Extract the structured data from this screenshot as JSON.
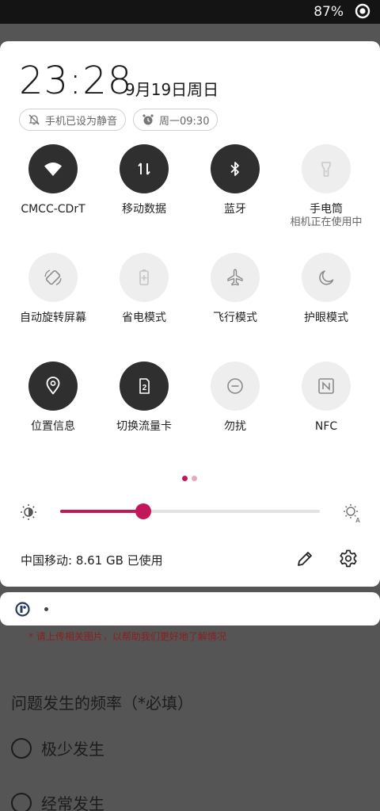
{
  "status_bar": {
    "battery_text": "87%",
    "status_icon": "target-icon"
  },
  "panel": {
    "time": "23:28",
    "date": "9月19日周日",
    "chips": [
      {
        "label": "手机已设为静音",
        "icon": "bell-off-icon"
      },
      {
        "label": "周一09:30",
        "icon": "alarm-clock-icon"
      }
    ],
    "tiles": [
      {
        "label": "CMCC-CDrT",
        "icon": "wifi-icon",
        "state": "on"
      },
      {
        "label": "移动数据",
        "icon": "mobile-data-icon",
        "state": "on"
      },
      {
        "label": "蓝牙",
        "icon": "bluetooth-icon",
        "state": "on"
      },
      {
        "label": "手电筒",
        "sublabel": "相机正在使用中",
        "icon": "flashlight-icon",
        "state": "disabled"
      },
      {
        "label": "自动旋转屏幕",
        "icon": "rotate-icon",
        "state": "off"
      },
      {
        "label": "省电模式",
        "icon": "battery-saver-icon",
        "state": "off"
      },
      {
        "label": "飞行模式",
        "icon": "airplane-icon",
        "state": "off"
      },
      {
        "label": "护眼模式",
        "icon": "moon-icon",
        "state": "off"
      },
      {
        "label": "位置信息",
        "icon": "location-icon",
        "state": "on"
      },
      {
        "label": "切换流量卡",
        "icon": "sim-card-icon",
        "state": "on",
        "icon_text": "2"
      },
      {
        "label": "勿扰",
        "icon": "do-not-disturb-icon",
        "state": "off"
      },
      {
        "label": "NFC",
        "icon": "nfc-icon",
        "state": "off"
      }
    ],
    "page_indicator": {
      "pages": 2,
      "current": 1
    },
    "brightness": {
      "level": 0.32
    },
    "data_usage": "中国移动: 8.61 GB 已使用",
    "edit_icon": "pencil-icon",
    "settings_icon": "gear-icon"
  },
  "notification": {
    "app_icon": "app-logo-icon"
  },
  "background_app": {
    "hint": "* 请上传相关图片，以帮助我们更好地了解情况",
    "question": "问题发生的频率（*必填）",
    "options": [
      "极少发生",
      "经常发生"
    ]
  },
  "colors": {
    "accent": "#c2185b",
    "tile_on": "#2f2f2f",
    "tile_off": "#eeeeee",
    "panel_bg": "#ffffff",
    "scrim": "#555555"
  }
}
